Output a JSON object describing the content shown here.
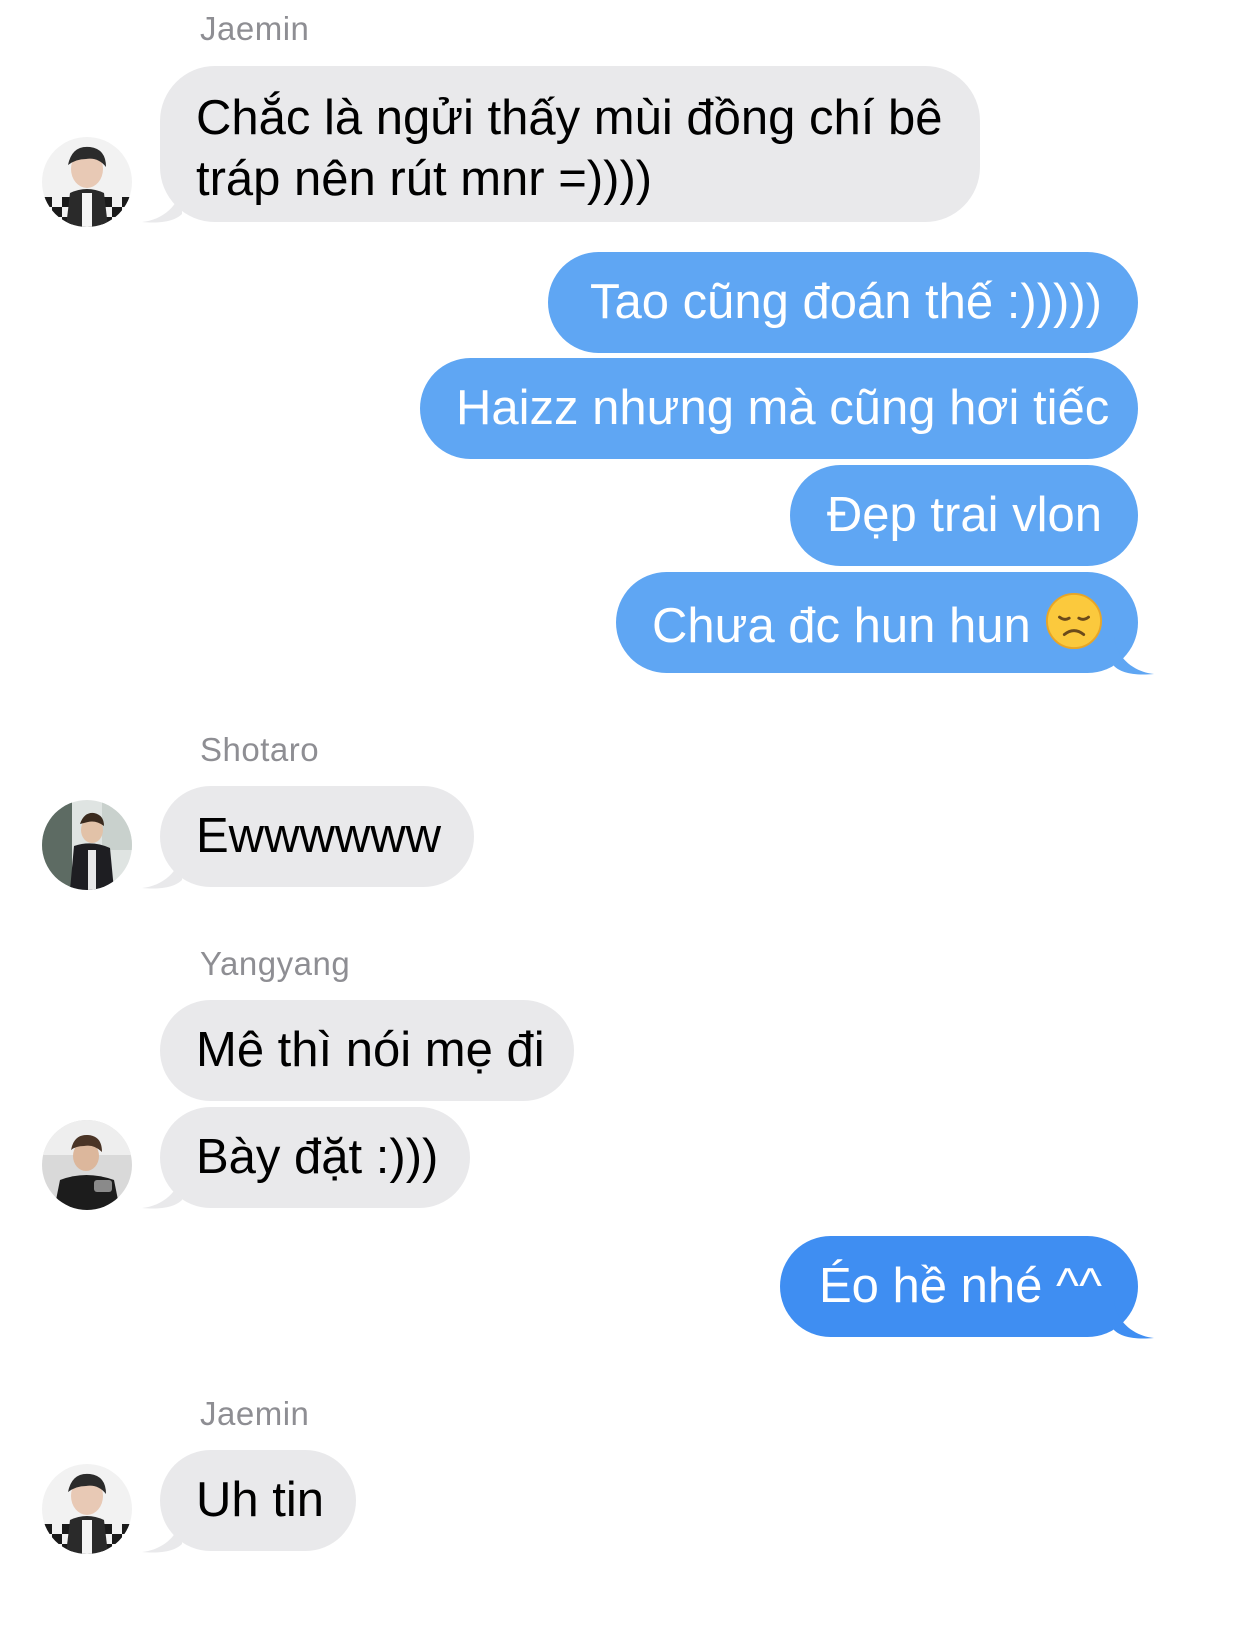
{
  "messages": {
    "m1": {
      "sender": "Jaemin",
      "line1": "Chắc là ngửi thấy mùi đồng chí bê",
      "line2": "tráp nên rút mnr =))))"
    },
    "m2": {
      "text": "Tao cũng đoán thế :)))))"
    },
    "m3": {
      "text": "Haizz nhưng mà cũng hơi tiếc"
    },
    "m4": {
      "text": "Đẹp trai vlon"
    },
    "m5": {
      "text": "Chưa đc hun hun",
      "emoji": "disappointed-face-icon"
    },
    "m6": {
      "sender": "Shotaro",
      "text": "Ewwwwww"
    },
    "m7": {
      "sender": "Yangyang",
      "text": "Mê thì nói mẹ đi"
    },
    "m8": {
      "text": "Bày đặt :)))"
    },
    "m9": {
      "text": "Éo hề nhé ^^"
    },
    "m10": {
      "sender": "Jaemin",
      "text": "Uh tin"
    }
  },
  "colors": {
    "incoming_bubble": "#e9e9eb",
    "outgoing_bubble": "#5fa6f3",
    "outgoing_bubble_latest": "#3f8ef2",
    "sender_name": "#8e8e93"
  }
}
